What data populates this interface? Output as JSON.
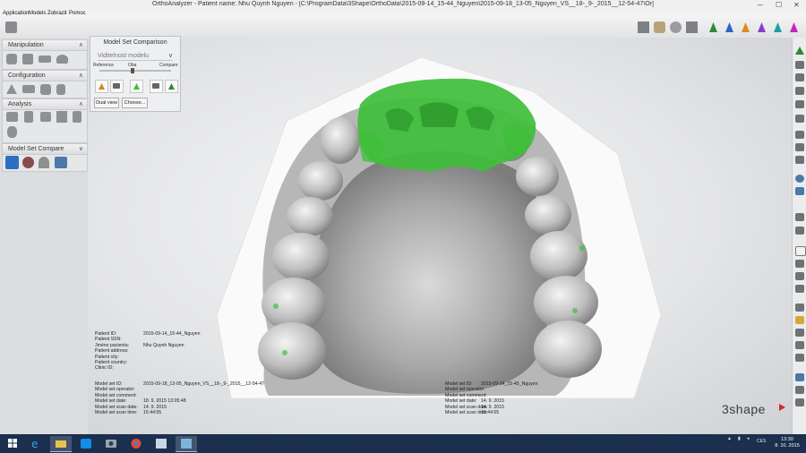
{
  "window": {
    "title": "OrthoAnalyzer - Patient name: Nhu Quynh Nguyen - [C:\\ProgramData\\3Shape\\OrthoData\\2015-09-14_15-44_Nguyen\\2015-09-18_13-05_Nguyen_VS__18-_9-_2015__12-54-47\\Or]",
    "minimize": "─",
    "maximize": "☐",
    "close": "✕"
  },
  "menu": [
    "Application",
    "Models",
    "Zobrazit",
    "Pomoc"
  ],
  "left_panel": {
    "sections": [
      {
        "title": "Manipulation",
        "caret": "∧"
      },
      {
        "title": "Configuration",
        "caret": "∧"
      },
      {
        "title": "Analysis",
        "caret": "∧"
      },
      {
        "title": "Model Set Compare",
        "caret": "∨"
      }
    ]
  },
  "comparison_panel": {
    "title": "Model Set Comparison",
    "visibility_select": "Viditelnost modelu",
    "caret": "∨",
    "labels": {
      "reference": "Reference",
      "both": "Oba",
      "compare": "Compare"
    },
    "slider_value": 0.5,
    "dual_view": "Dual view",
    "choose": "Choose..."
  },
  "patient_info": [
    {
      "key": "Patient ID:",
      "value": "2015-09-14_15-44_Nguyen"
    },
    {
      "key": "Patient SSN:",
      "value": ""
    },
    {
      "key": "Jméno pacienta:",
      "value": "Nhu Quynh Nguyen"
    },
    {
      "key": "Patient address:",
      "value": ""
    },
    {
      "key": "Patient city:",
      "value": ""
    },
    {
      "key": "Patient country:",
      "value": ""
    },
    {
      "key": "Clinic ID:",
      "value": ""
    }
  ],
  "model_set_left": [
    {
      "key": "Model set ID:",
      "value": "2015-09-18_13-05_Nguyen_VS__18-_9-_2015__12-54-47"
    },
    {
      "key": "Model set operator:",
      "value": ""
    },
    {
      "key": "Model set comment:",
      "value": ""
    },
    {
      "key": "Model set date:",
      "value": "18. 9. 2015 13:05:48"
    },
    {
      "key": "Model set scan date:",
      "value": "14. 9. 2015"
    },
    {
      "key": "Model set scan time:",
      "value": "15:44:55"
    }
  ],
  "model_set_right": [
    {
      "key": "Model set ID:",
      "value": "2015-09-14_15-45_Nguyen"
    },
    {
      "key": "Model set operator:",
      "value": ""
    },
    {
      "key": "Model set comment:",
      "value": ""
    },
    {
      "key": "Model set date:",
      "value": "14. 9. 2015"
    },
    {
      "key": "Model set scan date:",
      "value": "14. 9. 2015"
    },
    {
      "key": "Model set scan time:",
      "value": "15:44:55"
    }
  ],
  "brand": {
    "name": "3shape"
  },
  "taskbar": {
    "tray_lang": "CES",
    "time": "13:30",
    "date": "8. 10. 2015"
  },
  "colors": {
    "overlay_green": "#3fbe3a",
    "taskbar": "#1b2f4e",
    "tooth_gray": "#9a9a9a"
  }
}
